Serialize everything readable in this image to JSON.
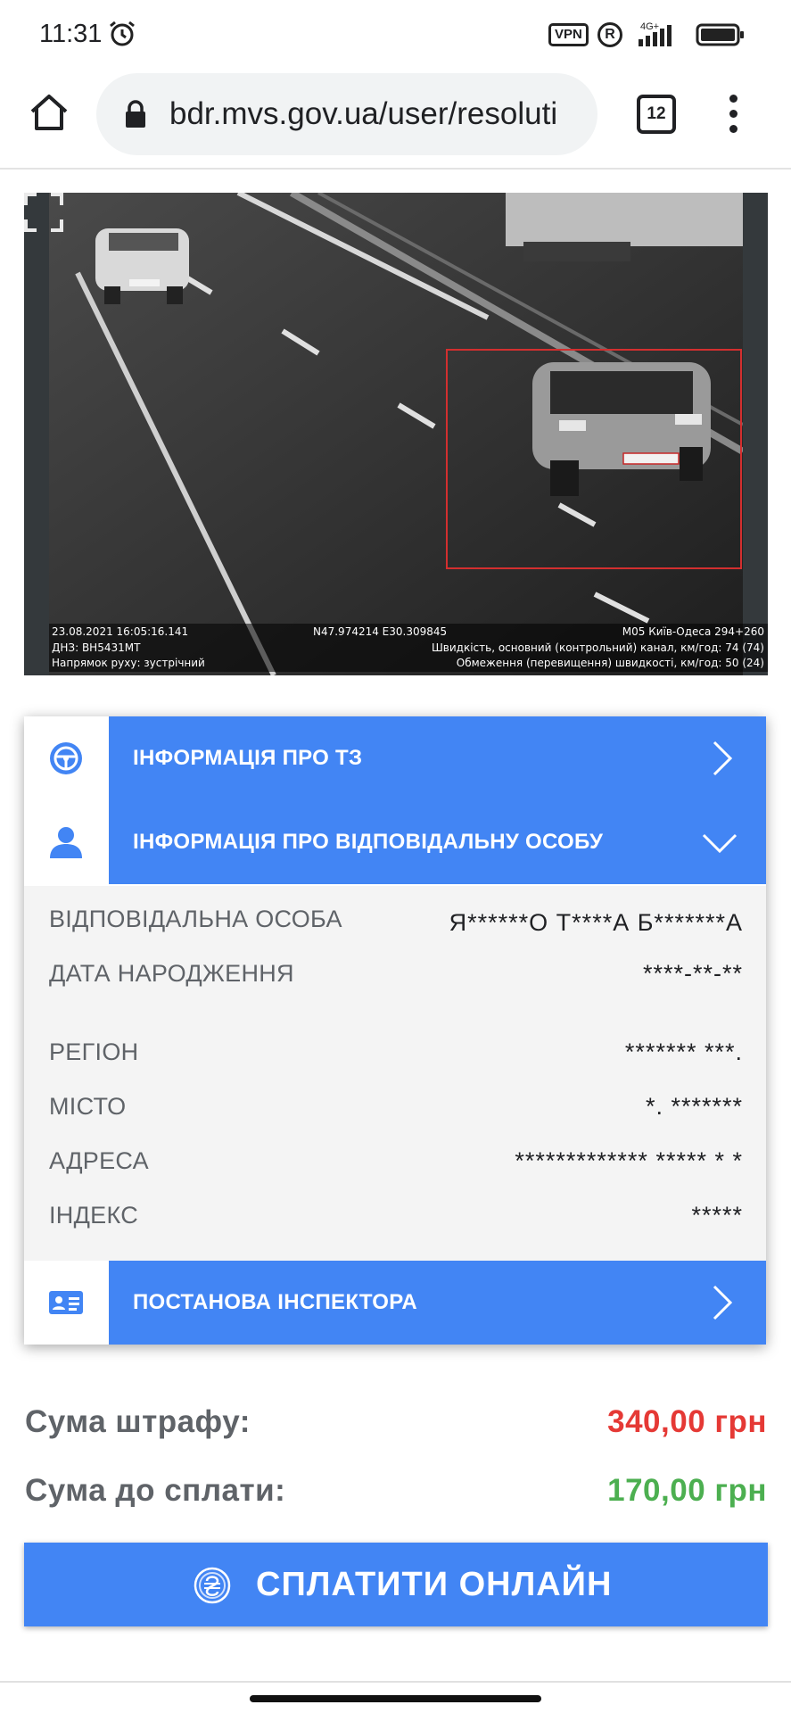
{
  "status_bar": {
    "time": "11:31",
    "vpn": "VPN",
    "registered": "R",
    "network": "4G+",
    "icons": [
      "alarm-icon",
      "signal-icon",
      "battery-icon"
    ]
  },
  "browser": {
    "url": "bdr.mvs.gov.ua/user/resoluti",
    "tab_count": "12",
    "icons": [
      "home-icon",
      "lock-icon",
      "more-vert-icon"
    ]
  },
  "photo": {
    "datetime": "23.08.2021 16:05:16.141",
    "coordinates": "N47.974214 E30.309845",
    "location": "М05 Київ-Одеса 294+260",
    "plate": "ДНЗ: ВН5431МТ",
    "speed": "Швидкість, основний (контрольний) канал, км/год: 74 (74)",
    "direction": "Напрямок руху: зустрічний",
    "limit": "Обмеження (перевищення) швидкості, км/год: 50 (24)"
  },
  "accordion": {
    "vehicle_info": "ІНФОРМАЦІЯ ПРО ТЗ",
    "person_info": "ІНФОРМАЦІЯ ПРО ВІДПОВІДАЛЬНУ ОСОБУ",
    "inspector_decision": "ПОСТАНОВА ІНСПЕКТОРА",
    "details": [
      {
        "label": "ВІДПОВІДАЛЬНА ОСОБА",
        "value": "Я******О Т****А Б*******А"
      },
      {
        "label": "ДАТА НАРОДЖЕННЯ",
        "value": "****-**-**"
      },
      {
        "label": "РЕГІОН",
        "value": "******* ***."
      },
      {
        "label": "МІСТО",
        "value": "*. *******"
      },
      {
        "label": "АДРЕСА",
        "value": "************* ***** * *"
      },
      {
        "label": "ІНДЕКС",
        "value": "*****"
      }
    ]
  },
  "fine": {
    "fine_label": "Сума штрафу:",
    "fine_value": "340,00 грн",
    "pay_label": "Сума до сплати:",
    "pay_value": "170,00 грн",
    "fine_color": "#e53935",
    "pay_color": "#4caf50"
  },
  "pay_button": {
    "label": "СПЛАТИТИ ОНЛАЙН"
  },
  "colors": {
    "accent": "#4285f4"
  }
}
